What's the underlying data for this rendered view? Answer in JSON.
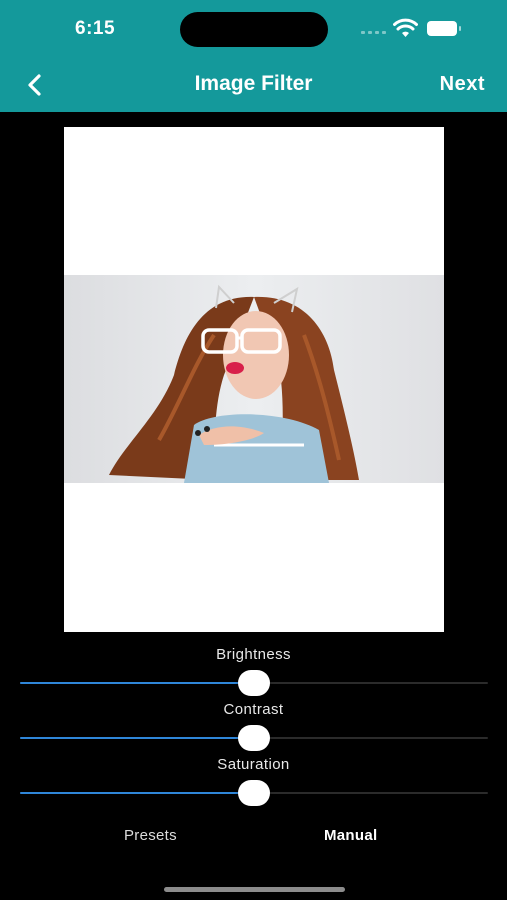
{
  "status_bar": {
    "time": "6:15"
  },
  "header": {
    "title": "Image Filter",
    "next_label": "Next",
    "back_icon": "chevron-left-icon",
    "background": "#14999b"
  },
  "sliders": [
    {
      "label": "Brightness",
      "value": 0.5
    },
    {
      "label": "Contrast",
      "value": 0.5
    },
    {
      "label": "Saturation",
      "value": 0.5
    }
  ],
  "slider_accent": "#2f86d9",
  "tabs": [
    {
      "label": "Presets",
      "selected": false
    },
    {
      "label": "Manual",
      "selected": true
    }
  ]
}
